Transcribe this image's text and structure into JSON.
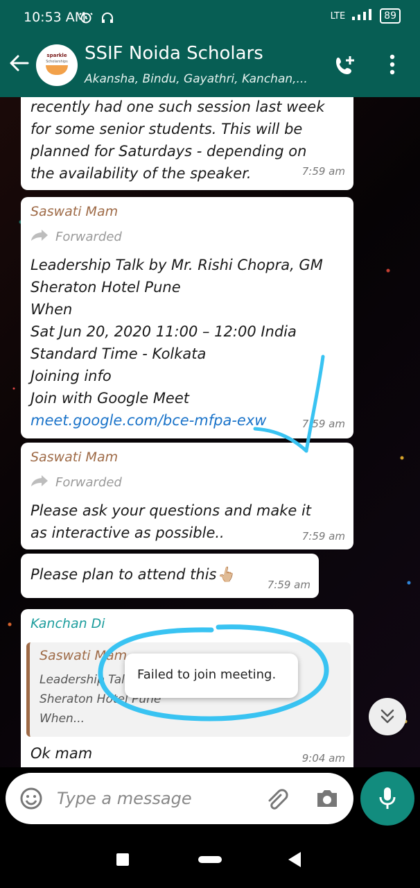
{
  "status_bar": {
    "time": "10:53 AM",
    "network": "LTE",
    "battery": "89",
    "icons": [
      "alarm-icon",
      "headphones-icon",
      "vo-lte-icon",
      "signal-icon",
      "battery-icon"
    ]
  },
  "header": {
    "avatar_text": "sparkle",
    "avatar_subtitle": "Scholarships",
    "title": "SSIF Noida Scholars",
    "subtitle": "Akansha, Bindu, Gayathri, Kanchan,...",
    "icons": [
      "back-arrow-icon",
      "add-call-icon",
      "more-vert-icon"
    ]
  },
  "chat": {
    "messages": [
      {
        "text": "recently had one such session last week\nfor some senior students. This will be\nplanned for Saturdays - depending on\nthe availability of the speaker.",
        "time": "7:59 am"
      },
      {
        "sender": "Saswati Mam",
        "forwarded": "Forwarded",
        "text": "Leadership Talk by Mr. Rishi Chopra, GM\nSheraton Hotel Pune\nWhen\nSat Jun 20, 2020 11:00 – 12:00 India\nStandard Time - Kolkata\nJoining info\nJoin with Google Meet",
        "link": "meet.google.com/bce-mfpa-exw",
        "time": "7:59 am"
      },
      {
        "sender": "Saswati Mam",
        "forwarded": "Forwarded",
        "text": "Please ask your questions and make it\nas interactive as possible..",
        "time": "7:59 am"
      },
      {
        "text": "Please plan to attend this",
        "emoji": "👆🏼",
        "time": "7:59 am"
      },
      {
        "sender": "Kanchan Di",
        "quoted_sender": "Saswati Mam",
        "quoted_text": "Leadership Talk by Mr. Rishi Chopra, GM\nSheraton Hotel Pune\nWhen...",
        "text": "Ok mam",
        "time": "9:04 am"
      }
    ]
  },
  "toast": {
    "text": "Failed to join meeting."
  },
  "composer": {
    "placeholder": "Type a message",
    "icons": [
      "emoji-icon",
      "attach-icon",
      "camera-icon",
      "mic-icon"
    ]
  },
  "colors": {
    "header": "#075e54",
    "accent": "#128c7e",
    "annotation": "#39c3f2",
    "sender_brown": "#9e6a46",
    "sender_teal": "#1a9c9c"
  }
}
